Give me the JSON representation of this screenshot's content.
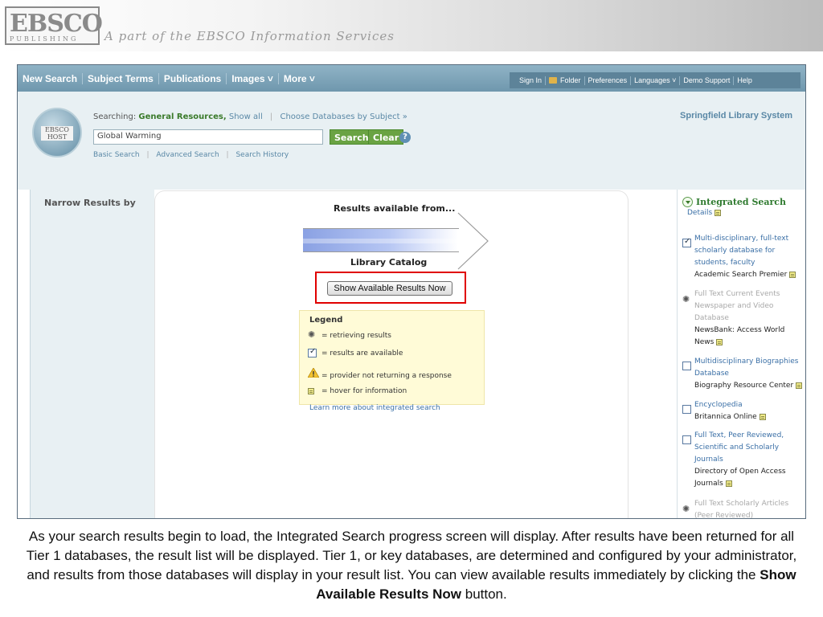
{
  "slide_header": {
    "logo_text": "EBSCO",
    "logo_subtext": "PUBLISHING",
    "tagline": "A part of the EBSCO Information Services"
  },
  "topnav": {
    "left_items": [
      "New Search",
      "Subject Terms",
      "Publications",
      "Images ˅",
      "More ˅"
    ],
    "right_items": [
      "Sign In",
      "Folder",
      "Preferences",
      "Languages ˅",
      "Demo Support",
      "Help"
    ]
  },
  "search": {
    "searching_label": "Searching:",
    "database_name": "General Resources,",
    "show_all": "Show all",
    "choose_db": "Choose Databases by Subject »",
    "query": "Global Warming",
    "search_button": "Search",
    "clear_button": "Clear",
    "links": [
      "Basic Search",
      "Advanced Search",
      "Search History"
    ],
    "library_name": "Springfield Library System",
    "ehost_logo_text": "EBSCO HOST"
  },
  "left_panel": {
    "title": "Narrow Results by"
  },
  "modal": {
    "title": "Results available from...",
    "catalog_label": "Library Catalog",
    "show_button": "Show Available Results Now",
    "legend_title": "Legend",
    "legend_items": [
      {
        "icon": "spinner-icon",
        "text": "= retrieving results"
      },
      {
        "icon": "checkbox-checked-icon",
        "text": "= results are available"
      },
      {
        "icon": "warning-icon",
        "text": "= provider not returning a response"
      },
      {
        "icon": "note-icon",
        "text": "= hover for information"
      }
    ],
    "learn_more": "Learn more about integrated search"
  },
  "right_panel": {
    "title": "Integrated Search",
    "details": "Details",
    "databases": [
      {
        "state": "checked",
        "desc": "Multi-disciplinary, full-text scholarly database for students, faculty",
        "provider": "Academic Search Premier"
      },
      {
        "state": "loading",
        "desc": "Full Text Current Events Newspaper and Video Database",
        "provider": "NewsBank: Access World News"
      },
      {
        "state": "unchecked",
        "desc": "Multidisciplinary Biographies Database",
        "provider": "Biography Resource Center"
      },
      {
        "state": "unchecked",
        "desc": "Encyclopedia",
        "provider": "Britannica Online"
      },
      {
        "state": "unchecked",
        "desc": "Full Text, Peer Reviewed, Scientific and Scholarly Journals",
        "provider": "Directory of Open Access Journals"
      },
      {
        "state": "loading",
        "desc": "Full Text Scholarly Articles (Peer Reviewed)",
        "provider": ""
      }
    ]
  },
  "caption": {
    "text": "As your search results begin to load, the Integrated Search progress screen will display. After results have been returned for all Tier 1 databases, the result list will be displayed. Tier 1, or key databases, are determined and configured by your administrator, and results from those databases will display in your result list. You can view available results immediately by clicking the ",
    "bold": "Show Available Results Now",
    "end": " button."
  },
  "colors": {
    "nav_bar": "#7aa0b5",
    "search_bg": "#e8f0f3",
    "accent_green": "#6aa343",
    "highlight_red": "#e00000",
    "legend_bg": "#fffbd7",
    "link_blue": "#3a6fa6"
  }
}
